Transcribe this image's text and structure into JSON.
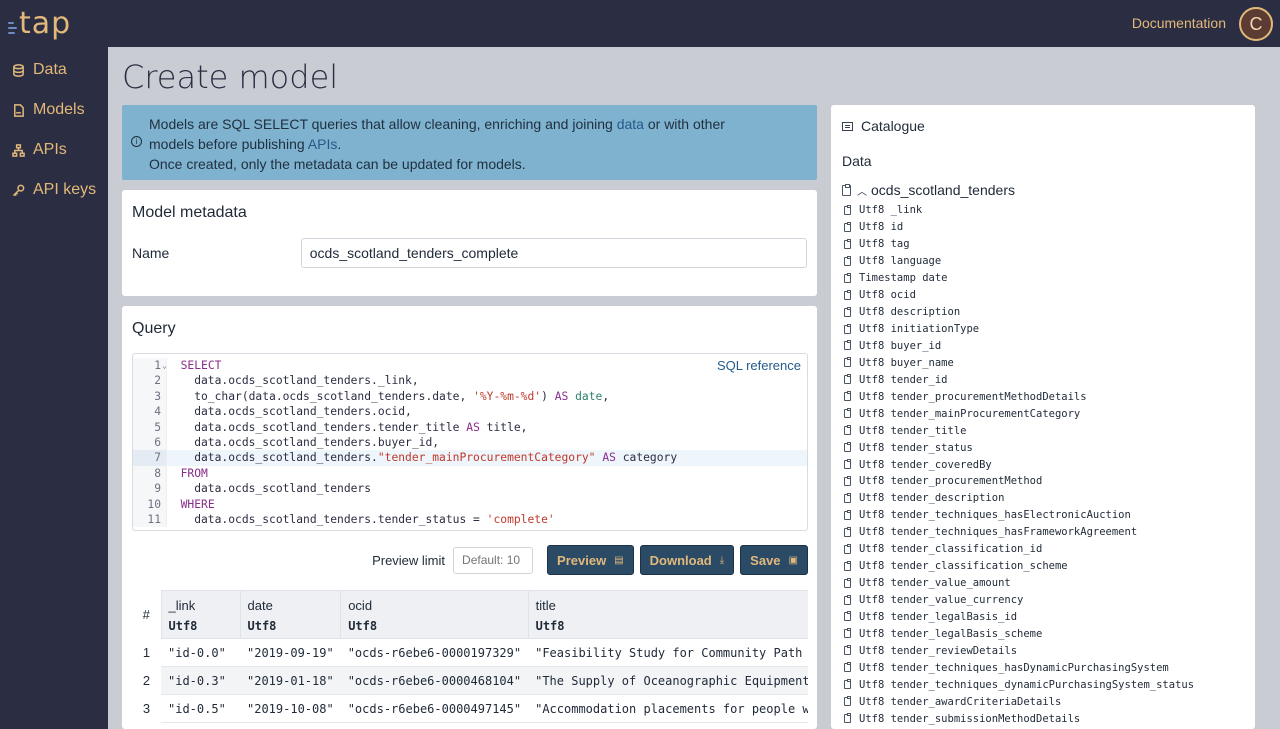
{
  "app": {
    "logo_text": "tap",
    "avatar_initial": "C"
  },
  "header": {
    "documentation_label": "Documentation"
  },
  "sidebar": {
    "items": [
      {
        "label": "Data",
        "icon": "database-icon"
      },
      {
        "label": "Models",
        "icon": "sql-file-icon"
      },
      {
        "label": "APIs",
        "icon": "api-network-icon"
      },
      {
        "label": "API keys",
        "icon": "key-icon"
      }
    ]
  },
  "page": {
    "title": "Create model"
  },
  "info": {
    "line1_prefix": "Models are SQL SELECT queries that allow cleaning, enriching and joining ",
    "data_link": "data",
    "line1_suffix": " or with other",
    "line2_prefix": "models before publishing ",
    "apis_link": "APIs",
    "line2_suffix": ".",
    "line3": "Once created, only the metadata can be updated for models."
  },
  "metadata": {
    "heading": "Model metadata",
    "name_label": "Name",
    "name_value": "ocds_scotland_tenders_complete"
  },
  "query": {
    "heading": "Query",
    "sql_reference": "SQL reference",
    "preview_limit_label": "Preview limit",
    "preview_limit_placeholder": "Default: 10",
    "preview_button": "Preview",
    "download_button": "Download",
    "save_button": "Save"
  },
  "results": {
    "index_header": "#",
    "columns": [
      {
        "name": "_link",
        "type": "Utf8"
      },
      {
        "name": "date",
        "type": "Utf8"
      },
      {
        "name": "ocid",
        "type": "Utf8"
      },
      {
        "name": "title",
        "type": "Utf8"
      }
    ],
    "rows": [
      {
        "index": "1",
        "cells": [
          "\"id-0.0\"",
          "\"2019-09-19\"",
          "\"ocds-r6ebe6-0000197329\"",
          "\"Feasibility Study for Community Path N"
        ]
      },
      {
        "index": "2",
        "cells": [
          "\"id-0.3\"",
          "\"2019-01-18\"",
          "\"ocds-r6ebe6-0000468104\"",
          "\"The Supply of Oceanographic Equipment\""
        ]
      },
      {
        "index": "3",
        "cells": [
          "\"id-0.5\"",
          "\"2019-10-08\"",
          "\"ocds-r6ebe6-0000497145\"",
          "\"Accommodation placements for people wi"
        ]
      }
    ]
  },
  "catalogue": {
    "title": "Catalogue",
    "section": "Data",
    "table_name": "ocds_scotland_tenders",
    "columns": [
      "Utf8 _link",
      "Utf8 id",
      "Utf8 tag",
      "Utf8 language",
      "Timestamp date",
      "Utf8 ocid",
      "Utf8 description",
      "Utf8 initiationType",
      "Utf8 buyer_id",
      "Utf8 buyer_name",
      "Utf8 tender_id",
      "Utf8 tender_procurementMethodDetails",
      "Utf8 tender_mainProcurementCategory",
      "Utf8 tender_title",
      "Utf8 tender_status",
      "Utf8 tender_coveredBy",
      "Utf8 tender_procurementMethod",
      "Utf8 tender_description",
      "Utf8 tender_techniques_hasElectronicAuction",
      "Utf8 tender_techniques_hasFrameworkAgreement",
      "Utf8 tender_classification_id",
      "Utf8 tender_classification_scheme",
      "Utf8 tender_value_amount",
      "Utf8 tender_value_currency",
      "Utf8 tender_legalBasis_id",
      "Utf8 tender_legalBasis_scheme",
      "Utf8 tender_reviewDetails",
      "Utf8 tender_techniques_hasDynamicPurchasingSystem",
      "Utf8 tender_techniques_dynamicPurchasingSystem_status",
      "Utf8 tender_awardCriteriaDetails",
      "Utf8 tender_submissionMethodDetails"
    ]
  },
  "colors": {
    "nav_background": "#2b2d42",
    "accent": "#e2b97a",
    "info_background": "#7fb2cf",
    "button_background": "#2b4a66"
  }
}
